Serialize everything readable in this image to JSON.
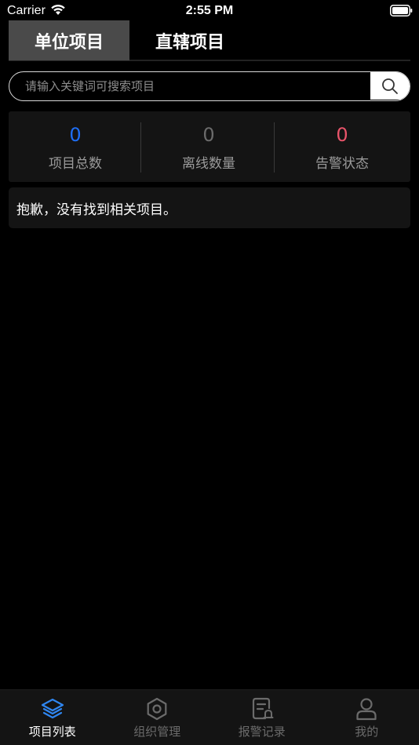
{
  "status_bar": {
    "carrier": "Carrier",
    "time": "2:55 PM"
  },
  "tabs": [
    {
      "label": "单位项目",
      "active": true
    },
    {
      "label": "直辖项目",
      "active": false
    }
  ],
  "search": {
    "placeholder": "请输入关键词可搜索项目",
    "value": ""
  },
  "stats": [
    {
      "value": "0",
      "label": "项目总数",
      "color": "#1e6ef5"
    },
    {
      "value": "0",
      "label": "离线数量",
      "color": "#6b6b6b"
    },
    {
      "value": "0",
      "label": "告警状态",
      "color": "#e8546a"
    }
  ],
  "empty_message": "抱歉，没有找到相关项目。",
  "tabbar": [
    {
      "label": "项目列表",
      "icon": "layers-icon",
      "active": true
    },
    {
      "label": "组织管理",
      "icon": "hexagon-icon",
      "active": false
    },
    {
      "label": "报警记录",
      "icon": "alarm-record-icon",
      "active": false
    },
    {
      "label": "我的",
      "icon": "person-icon",
      "active": false
    }
  ],
  "colors": {
    "accent": "#1e6ef5",
    "alarm": "#e8546a",
    "muted": "#6b6b6b"
  }
}
